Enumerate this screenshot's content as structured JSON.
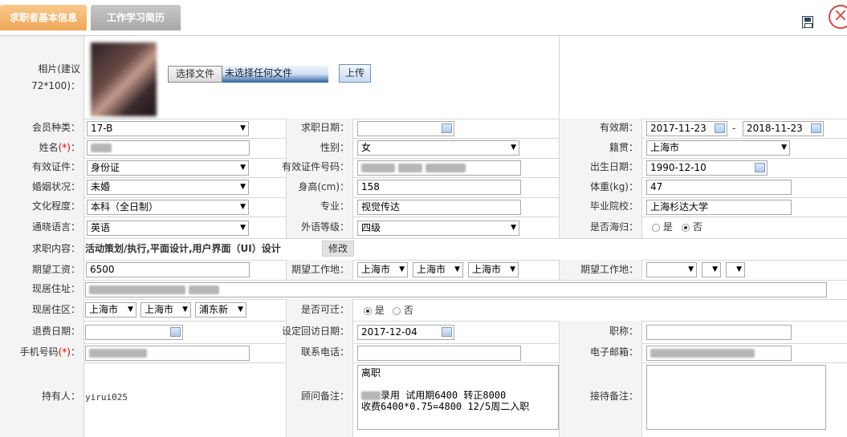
{
  "tabs": [
    {
      "label": "求职者基本信息"
    },
    {
      "label": "工作学习简历"
    }
  ],
  "icons": {
    "save": "save-icon",
    "close": "close-icon"
  },
  "photo": {
    "label": "相片(建议72*100)：",
    "file_button": "选择文件",
    "file_status": "未选择任何文件",
    "upload_button": "上传"
  },
  "fields": {
    "member_type": {
      "label": "会员种类：",
      "value": "17-B"
    },
    "job_date": {
      "label": "求职日期：",
      "value": ""
    },
    "validity": {
      "label": "有效期：",
      "from": "2017-11-23",
      "sep": "-",
      "to": "2018-11-23"
    },
    "name": {
      "label": "姓名",
      "req": "(*)",
      "colon": "："
    },
    "gender": {
      "label": "性别：",
      "value": "女"
    },
    "native_place": {
      "label": "籍贯：",
      "value": "上海市"
    },
    "id_type": {
      "label": "有效证件：",
      "value": "身份证"
    },
    "id_number": {
      "label": "有效证件号码："
    },
    "birth_date": {
      "label": "出生日期：",
      "value": "1990-12-10"
    },
    "marital": {
      "label": "婚姻状况：",
      "value": "未婚"
    },
    "height": {
      "label": "身高(cm)：",
      "value": "158"
    },
    "weight": {
      "label": "体重(kg)：",
      "value": "47"
    },
    "education": {
      "label": "文化程度：",
      "value": "本科（全日制）"
    },
    "major": {
      "label": "专业：",
      "value": "视觉传达"
    },
    "school": {
      "label": "毕业院校：",
      "value": "上海杉达大学"
    },
    "language": {
      "label": "通晓语言：",
      "value": "英语"
    },
    "language_level": {
      "label": "外语等级：",
      "value": "四级"
    },
    "overseas": {
      "label": "是否海归：",
      "opt_yes": "是",
      "opt_no": "否"
    },
    "job_content": {
      "label": "求职内容：",
      "value": "活动策划/执行,平面设计,用户界面（UI）设计",
      "edit_button": "修改"
    },
    "expected_salary": {
      "label": "期望工资：",
      "value": "6500"
    },
    "expected_location": {
      "label": "期望工作地：",
      "sel1": "上海市",
      "sel2": "上海市",
      "sel3": "上海市"
    },
    "expected_location2": {
      "label": "期望工作地：",
      "sel1": "",
      "sel2": "",
      "sel3": ""
    },
    "address": {
      "label": "现居住址："
    },
    "district": {
      "label": "现居住区：",
      "sel1": "上海市",
      "sel2": "上海市",
      "sel3": "浦东新"
    },
    "relocate": {
      "label": "是否可迁：",
      "opt_yes": "是",
      "opt_no": "否"
    },
    "refund_date": {
      "label": "退费日期：",
      "value": ""
    },
    "revisit_date": {
      "label": "设定回访日期：",
      "value": "2017-12-04"
    },
    "title": {
      "label": "职称：",
      "value": ""
    },
    "mobile": {
      "label": "手机号码",
      "req": "(*)",
      "colon": "："
    },
    "phone": {
      "label": "联系电话：",
      "value": ""
    },
    "email": {
      "label": "电子邮箱："
    },
    "owner": {
      "label": "持有人：",
      "value": "yirui025"
    },
    "consultant_note": {
      "label": "顾问备注：",
      "line1": "离职",
      "line2": "",
      "line3": "录用 试用期6400 转正8000",
      "line4": "收费6400*0.75=4800 12/5周二入职"
    },
    "reception_note": {
      "label": "接待备注：",
      "value": ""
    }
  }
}
